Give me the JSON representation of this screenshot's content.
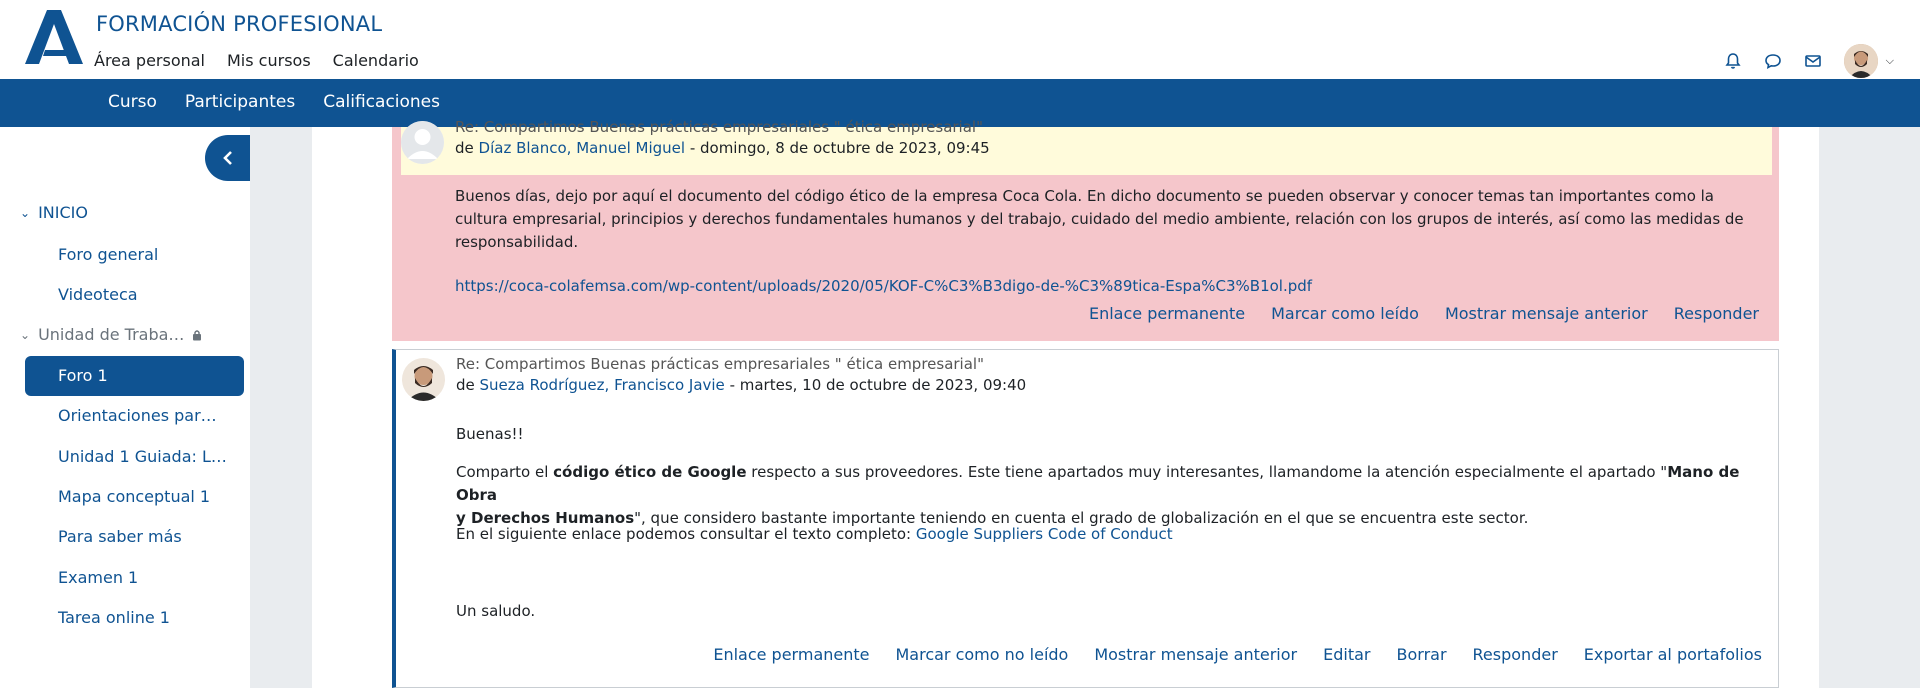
{
  "header": {
    "brand": "FORMACIÓN PROFESIONAL",
    "nav": [
      "Área personal",
      "Mis cursos",
      "Calendario"
    ],
    "icons": [
      "bell-icon",
      "chat-icon",
      "mail-icon",
      "user-avatar",
      "chevron-down-icon"
    ],
    "accent_color": "#0f5392"
  },
  "subnav": {
    "items": [
      "Curso",
      "Participantes",
      "Calificaciones"
    ]
  },
  "sidebar": {
    "section1": "INICIO",
    "items1": [
      "Foro general",
      "Videoteca"
    ],
    "section2": "Unidad de Traba…",
    "active_item": "Foro 1",
    "items2": [
      "Orientaciones par…",
      "Unidad 1 Guiada: L…",
      "Mapa conceptual 1",
      "Para saber más",
      "Examen 1",
      "Tarea online 1"
    ]
  },
  "post1": {
    "subject": "Re: Compartimos Buenas prácticas empresariales \" ética empresarial\"",
    "by": "de ",
    "author": "Díaz Blanco, Manuel Miguel",
    "date": " - domingo, 8 de octubre de 2023, 09:45",
    "para1_line1": "Buenos días, dejo por aquí el documento del código ético de la empresa Coca Cola. En dicho documento se pueden observar y conocer temas tan importantes como la",
    "para1_line2": "cultura empresarial, principios y derechos fundamentales humanos y del trabajo, cuidado del medio ambiente, relación con los grupos de interés, así como las medidas de",
    "para1_line3": "responsabilidad.",
    "link": "https://coca-colafemsa.com/wp-content/uploads/2020/05/KOF-C%C3%B3digo-de-%C3%89tica-Espa%C3%B1ol.pdf",
    "actions": [
      "Enlace permanente",
      "Marcar como leído",
      "Mostrar mensaje anterior",
      "Responder"
    ],
    "bg_color": "#f5c6cb",
    "header_color": "#fffbdb"
  },
  "post2": {
    "subject": "Re: Compartimos Buenas prácticas empresariales \" ética empresarial\"",
    "by": "de ",
    "author": "Sueza Rodríguez, Francisco Javie",
    "date": " - martes, 10 de octubre de 2023, 09:40",
    "greeting": "Buenas!!",
    "p2_a": "Comparto el ",
    "p2_b": "código ético de Google",
    "p2_c": " respecto a sus proveedores. Este tiene apartados muy interesantes, llamandome la atención especialmente el apartado \"",
    "p2_d": "Mano de Obra",
    "p2_e": "y Derechos Humanos",
    "p2_f": "\", que considero bastante importante teniendo en cuenta el grado de globalización en el que se encuentra este sector.",
    "p3": "En el siguiente enlace podemos consultar el texto completo: ",
    "p3_link": "Google Suppliers Code of Conduct",
    "closing": "Un saludo.",
    "actions": [
      "Enlace permanente",
      "Marcar como no leído",
      "Mostrar mensaje anterior",
      "Editar",
      "Borrar",
      "Responder",
      "Exportar al portafolios"
    ]
  }
}
